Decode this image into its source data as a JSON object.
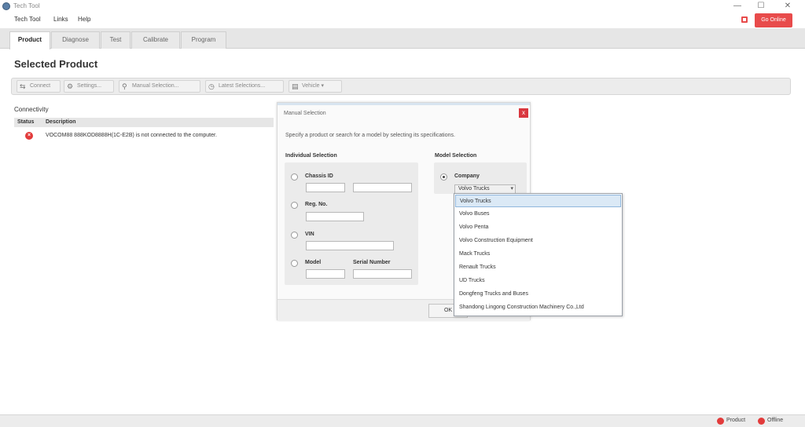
{
  "window": {
    "title": "Tech Tool",
    "minimize": "—",
    "maximize": "☐",
    "close": "✕"
  },
  "menu": {
    "items": [
      "Tech Tool",
      "Links",
      "Help"
    ],
    "red_button": "Go Online"
  },
  "tabs": [
    "Product",
    "Diagnose",
    "Test",
    "Calibrate",
    "Program"
  ],
  "page": {
    "title": "Selected Product"
  },
  "toolbar": {
    "connect": "Connect",
    "settings": "Settings...",
    "manual_selection": "Manual Selection...",
    "latest_selections": "Latest Selections...",
    "vehicle": "Vehicle ▾"
  },
  "connectivity": {
    "title": "Connectivity",
    "col_status": "Status",
    "col_description": "Description",
    "rows": [
      {
        "description": "VOCOM88 888KOD8888H(1C-E2B) is not connected to the computer."
      }
    ]
  },
  "dialog": {
    "title": "Manual Selection",
    "close": "x",
    "description": "Specify a product or search for a model by selecting its specifications.",
    "individual_label": "Individual Selection",
    "model_label": "Model Selection",
    "chassis_label": "Chassis ID",
    "reg_label": "Reg. No.",
    "vin_label": "VIN",
    "model_field_label": "Model",
    "serial_label": "Serial Number",
    "company_label": "Company",
    "company_value": "Volvo Trucks",
    "ok_label": "OK"
  },
  "dropdown": {
    "options": [
      "Volvo Trucks",
      "Volvo Buses",
      "Volvo Penta",
      "Volvo Construction Equipment",
      "Mack Trucks",
      "Renault Trucks",
      "UD Trucks",
      "Dongfeng Trucks and Buses",
      "Shandong Lingong Construction Machinery Co.,Ltd"
    ],
    "selected_index": 0
  },
  "status": {
    "product": "Product",
    "online": "Offline"
  },
  "colors": {
    "accent_red": "#e84b4b",
    "selection_blue": "#dbe9f6"
  }
}
